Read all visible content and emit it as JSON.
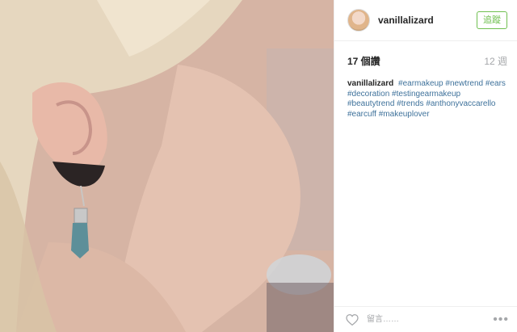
{
  "post": {
    "username": "vanillalizard",
    "follow_label": "追蹤",
    "likes_label": "17 個讚",
    "time_label": "12 週",
    "caption": {
      "user": "vanillalizard",
      "hashtags": [
        "#earmakeup",
        "#newtrend",
        "#ears",
        "#decoration",
        "#testingearmakeup",
        "#beautytrend",
        "#trends",
        "#anthonyvaccarello",
        "#earcuff",
        "#makeuplover"
      ]
    },
    "comment_placeholder": "留言……",
    "more_label": "•••"
  },
  "colors": {
    "follow": "#70c050",
    "hashtag": "#3f729b",
    "muted": "#a5a7aa"
  },
  "icons": [
    "heart-icon",
    "more-options-icon"
  ]
}
